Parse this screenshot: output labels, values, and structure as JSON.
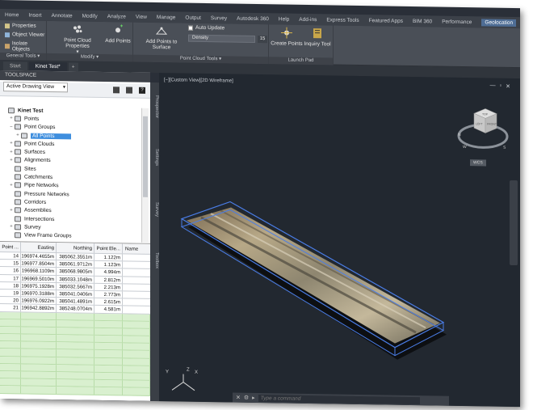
{
  "menubar": {
    "items": [
      "Home",
      "Insert",
      "Annotate",
      "Modify",
      "Analyze",
      "View",
      "Manage",
      "Output",
      "Survey",
      "Autodesk 360",
      "Help",
      "Add-ins",
      "Express Tools",
      "Featured Apps",
      "BIM 360",
      "Performance",
      "Geolocation"
    ],
    "active": "Geolocation"
  },
  "ribbon": {
    "properties_label": "Properties",
    "object_viewer_label": "Object Viewer",
    "isolate_objects_label": "Isolate Objects",
    "general_tools_label": "General Tools",
    "modify": {
      "point_cloud_properties": "Point Cloud Properties",
      "add_points": "Add Points",
      "label": "Modify"
    },
    "pct": {
      "add_points_to_surface": "Add Points to Surface",
      "auto_update": "Auto Update",
      "density_label": "Density",
      "density_value": "15",
      "label": "Point Cloud Tools"
    },
    "launch_pad": {
      "create_points": "Create Points",
      "inquiry_tool": "Inquiry Tool",
      "label": "Launch Pad"
    }
  },
  "doctabs": [
    {
      "label": "Start"
    },
    {
      "label": "Kinet Test*"
    },
    {
      "label": "+"
    }
  ],
  "toolspace": {
    "title": "TOOLSPACE",
    "view_select": "Active Drawing View",
    "tree": [
      {
        "label": "Kinet Test",
        "expander": "",
        "level": 0
      },
      {
        "label": "Points",
        "expander": "+",
        "level": 1
      },
      {
        "label": "Point Groups",
        "expander": "−",
        "level": 1
      },
      {
        "label": "All Points",
        "expander": "+",
        "level": 2
      },
      {
        "label": "Point Clouds",
        "expander": "+",
        "level": 1
      },
      {
        "label": "Surfaces",
        "expander": "+",
        "level": 1
      },
      {
        "label": "Alignments",
        "expander": "+",
        "level": 1
      },
      {
        "label": "Sites",
        "expander": "",
        "level": 1
      },
      {
        "label": "Catchments",
        "expander": "",
        "level": 1
      },
      {
        "label": "Pipe Networks",
        "expander": "+",
        "level": 1
      },
      {
        "label": "Pressure Networks",
        "expander": "",
        "level": 1
      },
      {
        "label": "Corridors",
        "expander": "",
        "level": 1
      },
      {
        "label": "Assemblies",
        "expander": "+",
        "level": 1
      },
      {
        "label": "Intersections",
        "expander": "",
        "level": 1
      },
      {
        "label": "Survey",
        "expander": "+",
        "level": 1
      },
      {
        "label": "View Frame Groups",
        "expander": "",
        "level": 1
      }
    ],
    "selected": "All Points",
    "side_tabs": [
      "Prospector",
      "Settings",
      "Survey",
      "Toolbox"
    ]
  },
  "table": {
    "headers": [
      "Point ...",
      "Easting",
      "Northing",
      "Point Ele...",
      "Name"
    ],
    "rows": [
      [
        "14",
        "196974.4655m",
        "385062.3551m",
        "1.122m",
        ""
      ],
      [
        "15",
        "196977.8504m",
        "385061.9712m",
        "1.123m",
        ""
      ],
      [
        "16",
        "196968.1109m",
        "385068.9805m",
        "4.994m",
        ""
      ],
      [
        "17",
        "196969.5010m",
        "385033.1048m",
        "2.812m",
        ""
      ],
      [
        "18",
        "196975.1928m",
        "385032.5667m",
        "2.213m",
        ""
      ],
      [
        "19",
        "196970.3188m",
        "385041.0406m",
        "2.773m",
        ""
      ],
      [
        "20",
        "196976.0922m",
        "385041.4891m",
        "2.615m",
        ""
      ],
      [
        "21",
        "196942.8892m",
        "385248.0704m",
        "4.581m",
        ""
      ]
    ],
    "green_rows": 11
  },
  "viewport": {
    "label": "[−][Custom View][2D Wireframe]",
    "controls": [
      "—",
      "▫",
      "✕"
    ],
    "viewcube": {
      "top": "TOP",
      "left": "LEFT",
      "front": "FRONT"
    },
    "compass": {
      "n": "N",
      "s": "S",
      "w": "W"
    },
    "wcs": "WCS",
    "ucs": {
      "x": "X",
      "y": "Y",
      "z": "Z"
    }
  },
  "command_line": {
    "placeholder": "Type a command"
  }
}
